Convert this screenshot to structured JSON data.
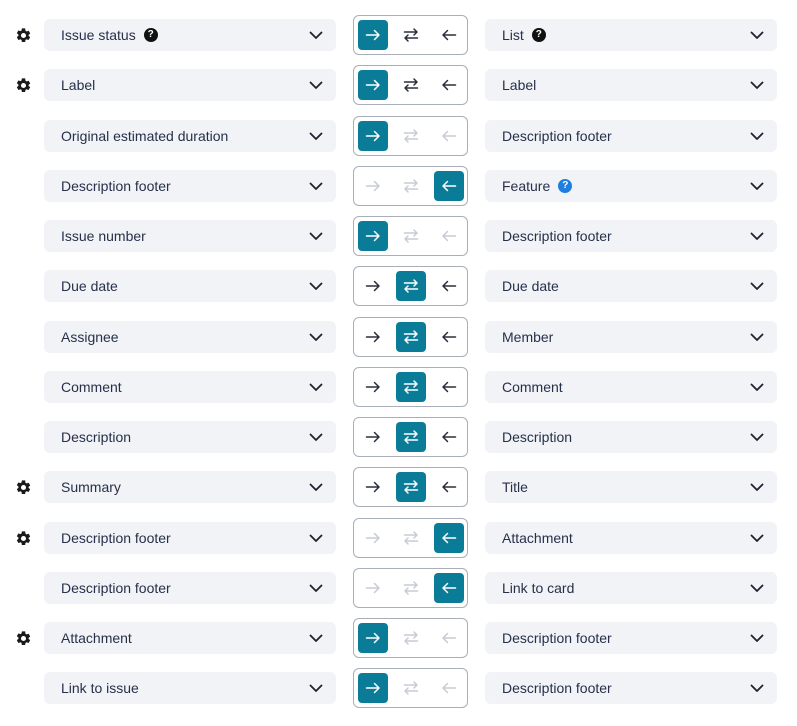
{
  "colors": {
    "accent": "#0b7c98",
    "select_bg": "#f1f3f6",
    "help_dark": "#111111",
    "help_blue": "#1f7fe0"
  },
  "direction_icons": [
    "arrow-right-icon",
    "arrows-both-icon",
    "arrow-left-icon"
  ],
  "rows": [
    {
      "gear": true,
      "left": "Issue status",
      "left_help": "?",
      "right": "List",
      "right_help": "?",
      "right_help_color": "dark",
      "selected": "right",
      "available": [
        "right",
        "both",
        "left"
      ]
    },
    {
      "gear": true,
      "left": "Label",
      "right": "Label",
      "selected": "right",
      "available": [
        "right",
        "both",
        "left"
      ]
    },
    {
      "gear": false,
      "left": "Original estimated duration",
      "right": "Description footer",
      "selected": "right",
      "available": [
        "right"
      ]
    },
    {
      "gear": false,
      "left": "Description footer",
      "right": "Feature",
      "right_help": "?",
      "right_help_color": "blue",
      "selected": "left",
      "available": [
        "left"
      ]
    },
    {
      "gear": false,
      "left": "Issue number",
      "right": "Description footer",
      "selected": "right",
      "available": [
        "right"
      ]
    },
    {
      "gear": false,
      "left": "Due date",
      "right": "Due date",
      "selected": "both",
      "available": [
        "right",
        "both",
        "left"
      ]
    },
    {
      "gear": false,
      "left": "Assignee",
      "right": "Member",
      "selected": "both",
      "available": [
        "right",
        "both",
        "left"
      ]
    },
    {
      "gear": false,
      "left": "Comment",
      "right": "Comment",
      "selected": "both",
      "available": [
        "right",
        "both",
        "left"
      ]
    },
    {
      "gear": false,
      "left": "Description",
      "right": "Description",
      "selected": "both",
      "available": [
        "right",
        "both",
        "left"
      ]
    },
    {
      "gear": true,
      "left": "Summary",
      "right": "Title",
      "selected": "both",
      "available": [
        "right",
        "both",
        "left"
      ]
    },
    {
      "gear": true,
      "left": "Description footer",
      "right": "Attachment",
      "selected": "left",
      "available": [
        "left"
      ]
    },
    {
      "gear": false,
      "left": "Description footer",
      "right": "Link to card",
      "selected": "left",
      "available": [
        "left"
      ]
    },
    {
      "gear": true,
      "left": "Attachment",
      "right": "Description footer",
      "selected": "right",
      "available": [
        "right"
      ]
    },
    {
      "gear": false,
      "left": "Link to issue",
      "right": "Description footer",
      "selected": "right",
      "available": [
        "right"
      ]
    }
  ]
}
